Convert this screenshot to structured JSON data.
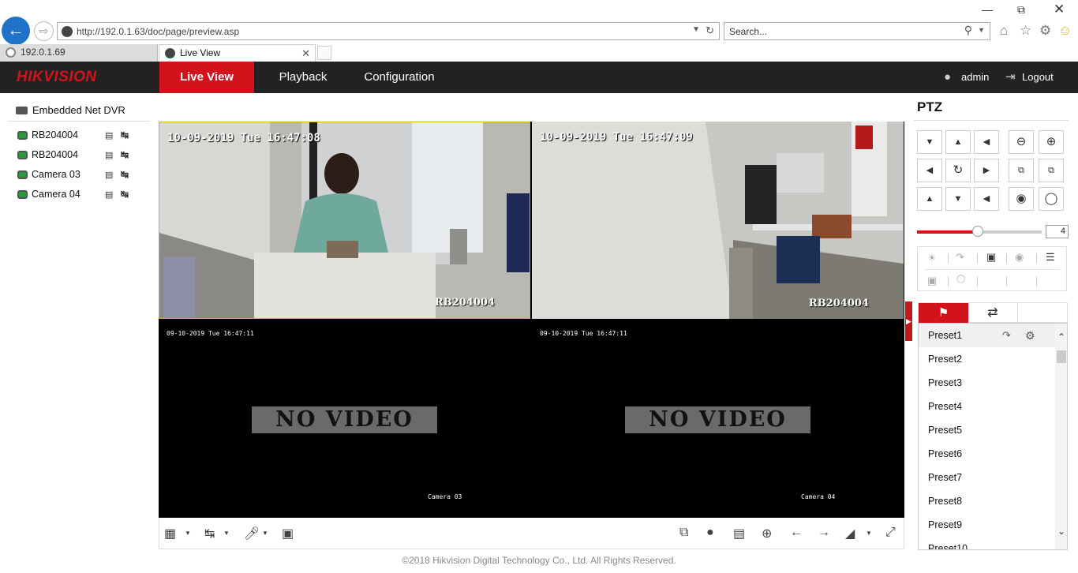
{
  "browser": {
    "url": "http://192.0.1.63/doc/page/preview.asp",
    "search_placeholder": "Search...",
    "tabs": [
      {
        "label": "192.0.1.69"
      },
      {
        "label": "Live View"
      }
    ]
  },
  "app": {
    "brand": "HIKVISION",
    "nav": {
      "live": "Live View",
      "playback": "Playback",
      "config": "Configuration"
    },
    "user": "admin",
    "logout": "Logout",
    "accent_color": "#d2131b"
  },
  "tree": {
    "root": "Embedded Net DVR",
    "cameras": [
      {
        "label": "RB204004"
      },
      {
        "label": "RB204004"
      },
      {
        "label": "Camera 03"
      },
      {
        "label": "Camera 04"
      }
    ]
  },
  "tiles": [
    {
      "timestamp": "10-09-2019 Tue 16:47:08",
      "name": "RB204004"
    },
    {
      "timestamp": "10-09-2019 Tue 16:47:09",
      "name": "RB204004"
    },
    {
      "timestamp": "09-10-2019 Tue 16:47:11",
      "name": "Camera 03",
      "status": "NO VIDEO"
    },
    {
      "timestamp": "09-10-2019 Tue 16:47:11",
      "name": "Camera 04",
      "status": "NO VIDEO"
    }
  ],
  "footer": "©2018 Hikvision Digital Technology Co., Ltd. All Rights Reserved.",
  "ptz": {
    "title": "PTZ",
    "speed": 4,
    "speed_max": 7,
    "presets": [
      "Preset1",
      "Preset2",
      "Preset3",
      "Preset4",
      "Preset5",
      "Preset6",
      "Preset7",
      "Preset8",
      "Preset9",
      "Preset10"
    ]
  }
}
